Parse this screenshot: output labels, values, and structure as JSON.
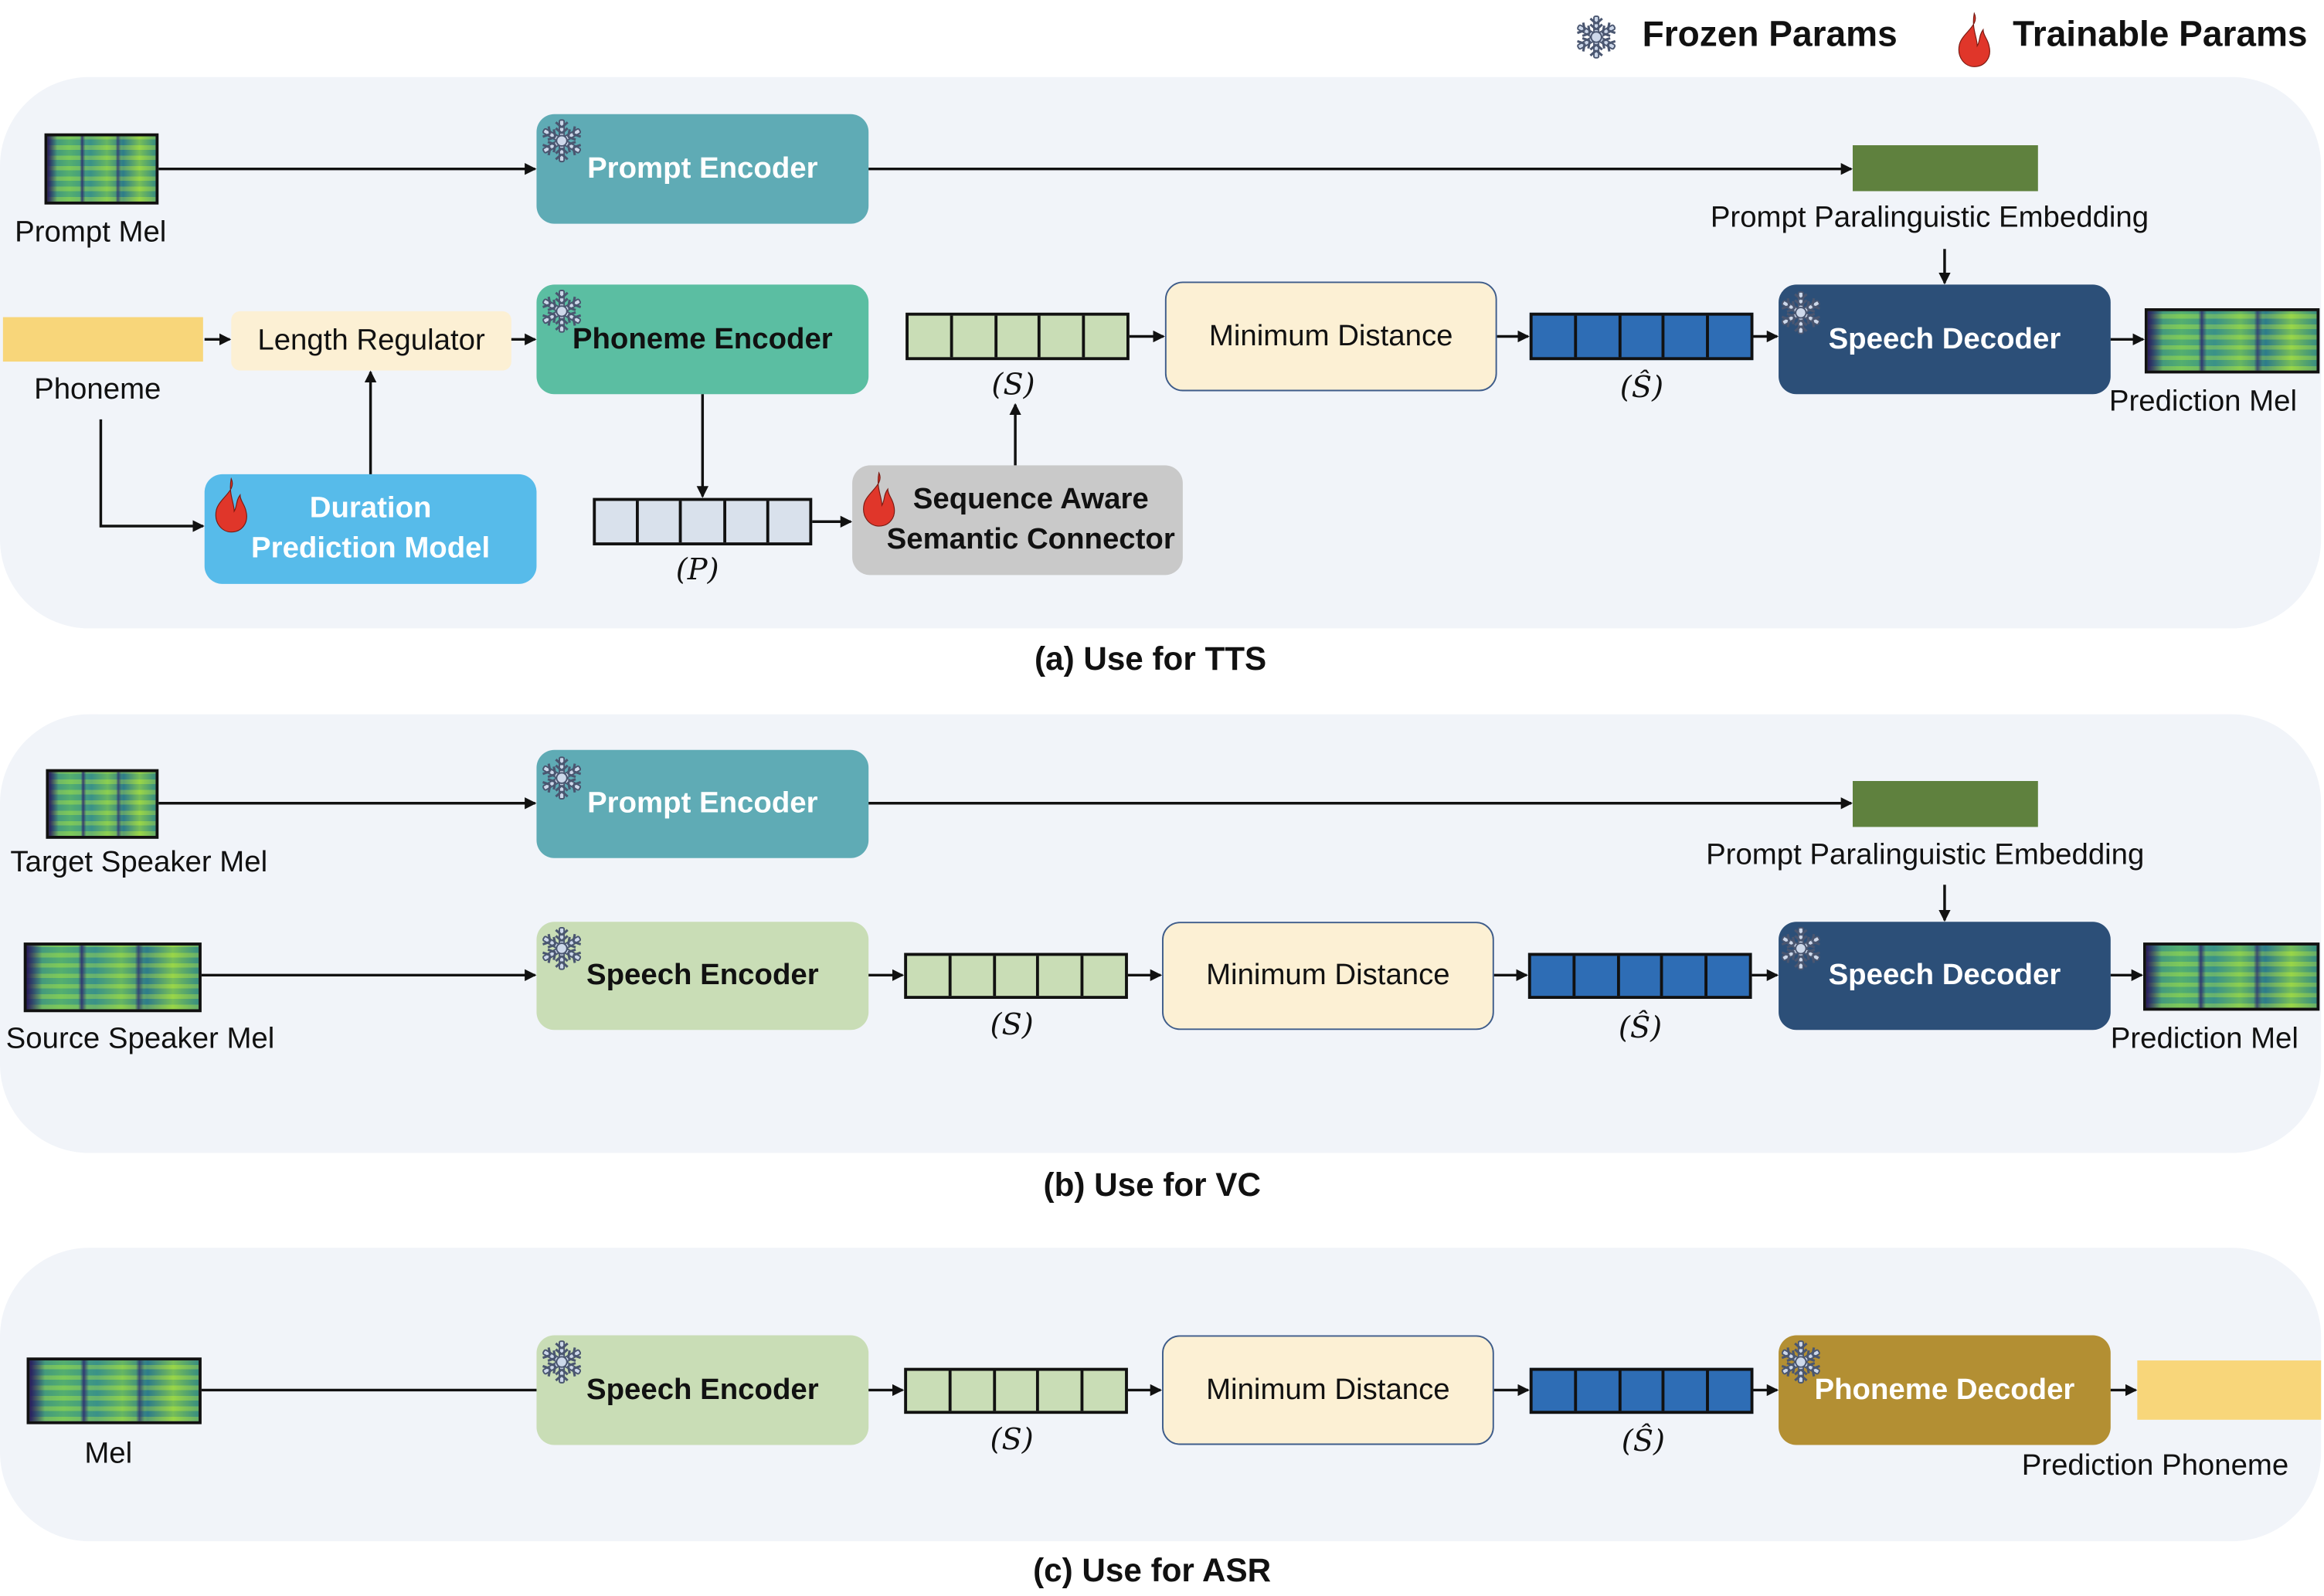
{
  "legend": {
    "frozen_label": "Frozen Params",
    "trainable_label": "Trainable Params",
    "frozen_icon": "snowflake-icon",
    "trainable_icon": "flame-icon"
  },
  "colors": {
    "panel_bg": "#f1f4f9",
    "prompt_encoder": "#5fabb5",
    "phoneme_encoder": "#5bbea2",
    "duration_model": "#57bbea",
    "semantic_connector": "#c9c9c9",
    "minimum_distance": "#fcf0d4",
    "speech_decoder": "#2c4f78",
    "speech_encoder": "#c9ddb6",
    "phoneme_decoder": "#b38f33",
    "paralinguistic_embedding": "#5f813e",
    "phoneme_bar": "#f8d67a",
    "seq_s": "#c9ddb6",
    "seq_p": "#d9e1ec",
    "seq_shat": "#2e6db5",
    "flame": "#e0362a",
    "snowflake": "#cdd8ea"
  },
  "tts": {
    "caption": "(a) Use for TTS",
    "prompt_mel_label": "Prompt Mel",
    "prompt_encoder_label": "Prompt Encoder",
    "embedding_label": "Prompt Paralinguistic Embedding",
    "phoneme_label": "Phoneme",
    "length_regulator_label": "Length Regulator",
    "phoneme_encoder_label": "Phoneme Encoder",
    "duration_model_label_1": "Duration",
    "duration_model_label_2": "Prediction Model",
    "p_seq_label": "(P)",
    "connector_label_1": "Sequence Aware",
    "connector_label_2": "Semantic Connector",
    "s_seq_label": "(S)",
    "minimum_distance_label": "Minimum Distance",
    "shat_seq_label": "(Ŝ)",
    "speech_decoder_label": "Speech Decoder",
    "prediction_mel_label": "Prediction Mel"
  },
  "vc": {
    "caption": "(b) Use for VC",
    "target_mel_label": "Target Speaker Mel",
    "prompt_encoder_label": "Prompt Encoder",
    "embedding_label": "Prompt Paralinguistic  Embedding",
    "source_mel_label": "Source Speaker Mel",
    "speech_encoder_label": "Speech  Encoder",
    "s_seq_label": "(S)",
    "minimum_distance_label": "Minimum Distance",
    "shat_seq_label": "(Ŝ)",
    "speech_decoder_label": "Speech Decoder",
    "prediction_mel_label": "Prediction Mel"
  },
  "asr": {
    "caption": "(c) Use for ASR",
    "mel_label": "Mel",
    "speech_encoder_label": "Speech  Encoder",
    "s_seq_label": "(S)",
    "minimum_distance_label": "Minimum Distance",
    "shat_seq_label": "(Ŝ)",
    "phoneme_decoder_label": "Phoneme Decoder",
    "prediction_phoneme_label": "Prediction  Phoneme"
  }
}
